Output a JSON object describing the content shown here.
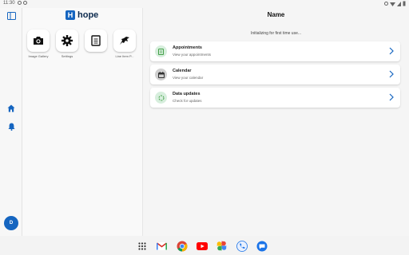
{
  "status_bar": {
    "time": "11:30"
  },
  "app": {
    "logo_text": "hope",
    "logo_letter": "H"
  },
  "shortcuts": [
    {
      "label": "Image Gallery",
      "icon": "camera-icon"
    },
    {
      "label": "Settings",
      "icon": "gear-icon"
    },
    {
      "label": "",
      "icon": "document-icon"
    },
    {
      "label": "Line Item P...",
      "icon": "animal-icon"
    }
  ],
  "main": {
    "title": "Name",
    "status_text": "Initializing for first time use...",
    "cards": [
      {
        "title": "Appointments",
        "subtitle": "View your appointments",
        "icon": "appointments-icon",
        "icon_bg": "#d7eedd",
        "icon_color": "#43a047"
      },
      {
        "title": "Calendar",
        "subtitle": "View your calendar",
        "icon": "calendar-icon",
        "icon_bg": "#cfcfcf",
        "icon_color": "#333333"
      },
      {
        "title": "Data updates",
        "subtitle": "Check for updates",
        "icon": "sync-icon",
        "icon_bg": "#d7eedd",
        "icon_color": "#43a047"
      }
    ]
  },
  "rail": {
    "avatar_initial": "D",
    "accent": "#1565c0"
  },
  "dock": [
    "apps-grid-icon",
    "gmail-icon",
    "chrome-icon",
    "youtube-icon",
    "photos-icon",
    "phone-icon",
    "messages-icon"
  ]
}
